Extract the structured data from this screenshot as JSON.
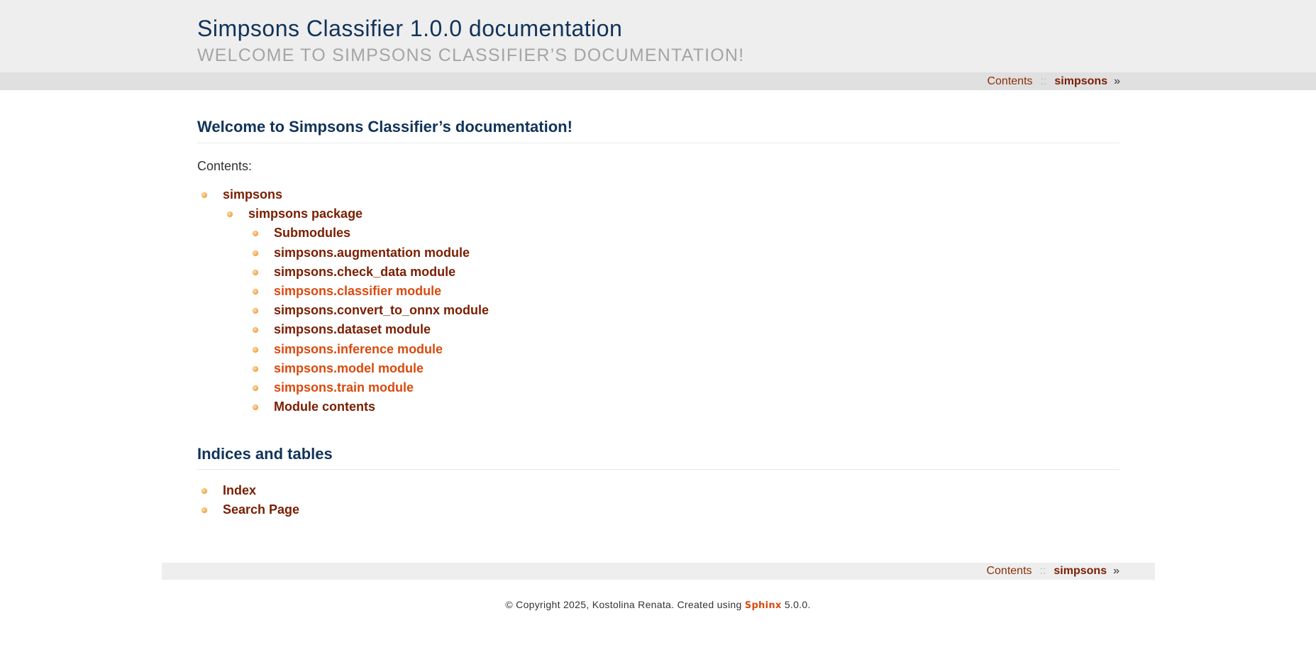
{
  "header": {
    "title": "Simpsons Classifier 1.0.0 documentation",
    "subtitle": "WELCOME TO SIMPSONS CLASSIFIER’S DOCUMENTATION!"
  },
  "relnav": {
    "contents": "Contents",
    "separator": "::",
    "next": "simpsons",
    "raquo": "»"
  },
  "main": {
    "heading": "Welcome to Simpsons Classifier’s documentation!",
    "caption": "Contents:",
    "toc": {
      "l1": "simpsons",
      "l2": "simpsons package",
      "l3": [
        "Submodules",
        "simpsons.augmentation module",
        "simpsons.check_data module",
        "simpsons.classifier module",
        "simpsons.convert_to_onnx module",
        "simpsons.dataset module",
        "simpsons.inference module",
        "simpsons.model module",
        "simpsons.train module",
        "Module contents"
      ]
    }
  },
  "indices": {
    "heading": "Indices and tables",
    "items": [
      "Index",
      "Search Page"
    ]
  },
  "footer": {
    "prefix": "© Copyright 2025, Kostolina Renata. Created using",
    "link": "Sphinx",
    "suffix": "5.0.0."
  },
  "colors": {
    "link": "#7a1e00",
    "visited_link": "#d94a0f",
    "heading": "#11335a"
  }
}
